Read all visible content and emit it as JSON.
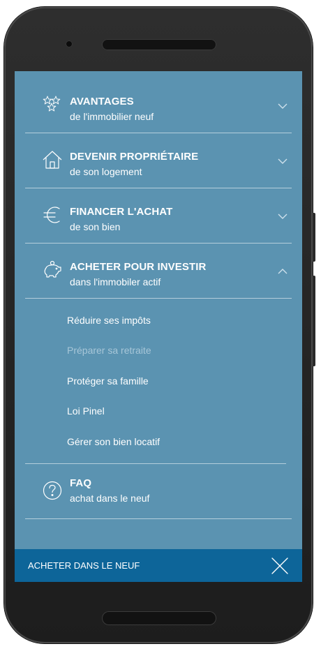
{
  "menu": {
    "items": [
      {
        "title": "AVANTAGES",
        "subtitle": "de l'immobilier neuf",
        "icon": "stars-icon",
        "chevron": "chevron-down-icon"
      },
      {
        "title": "DEVENIR PROPRIÉTAIRE",
        "subtitle": "de son logement",
        "icon": "house-icon",
        "chevron": "chevron-down-icon"
      },
      {
        "title": "FINANCER L'ACHAT",
        "subtitle": "de son bien",
        "icon": "euro-icon",
        "chevron": "chevron-down-icon"
      },
      {
        "title": "ACHETER POUR INVESTIR",
        "subtitle": "dans l'immobiler actif",
        "icon": "piggy-bank-icon",
        "chevron": "chevron-up-icon"
      },
      {
        "title": "FAQ",
        "subtitle": "achat dans le neuf",
        "icon": "question-circle-icon",
        "chevron": ""
      }
    ],
    "submenu": [
      {
        "label": "Réduire ses impôts",
        "state": "normal"
      },
      {
        "label": "Préparer sa retraite",
        "state": "muted"
      },
      {
        "label": "Protéger sa famille",
        "state": "normal"
      },
      {
        "label": "Loi Pinel",
        "state": "normal"
      },
      {
        "label": "Gérer son bien locatif",
        "state": "normal"
      }
    ]
  },
  "bottom_bar": {
    "label": "ACHETER DANS LE NEUF",
    "close_icon": "close-icon"
  },
  "colors": {
    "screen_bg": "#5b93b1",
    "bottom_bar": "#0d6599",
    "muted_link": "#a7c6d8",
    "text": "#ffffff"
  }
}
